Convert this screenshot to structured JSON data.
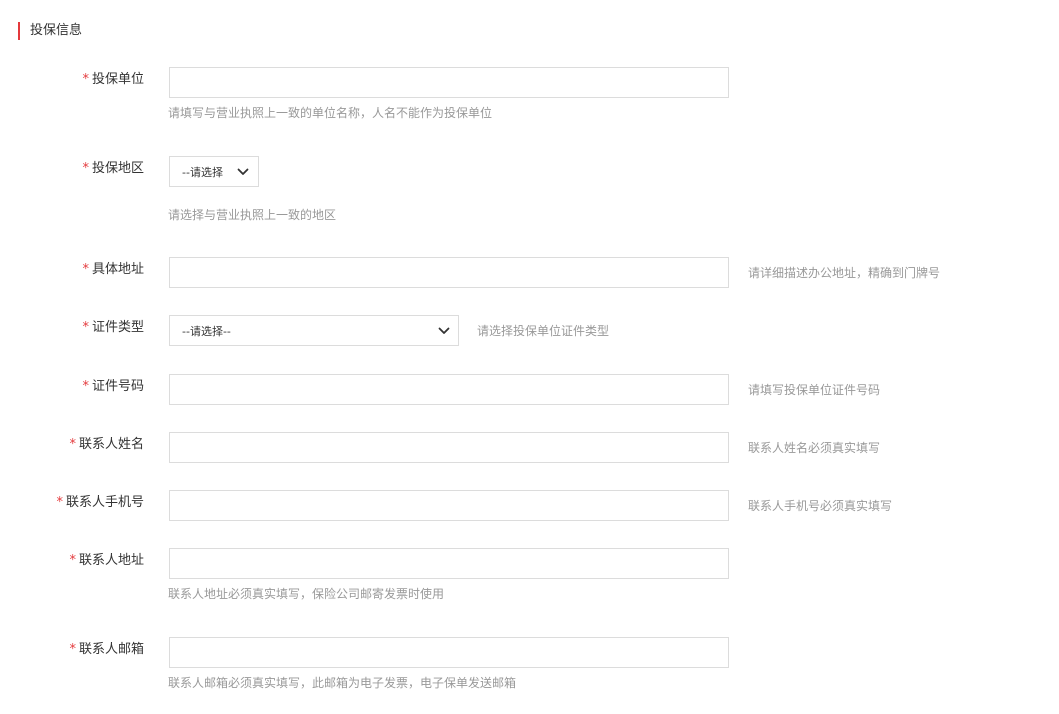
{
  "section": {
    "title": "投保信息"
  },
  "fields": {
    "company": {
      "required": "*",
      "label": "投保单位",
      "value": "",
      "hint": "请填写与营业执照上一致的单位名称，人名不能作为投保单位"
    },
    "region": {
      "required": "*",
      "label": "投保地区",
      "selected": "--请选择",
      "hint": "请选择与营业执照上一致的地区"
    },
    "address": {
      "required": "*",
      "label": "具体地址",
      "value": "",
      "hint": "请详细描述办公地址，精确到门牌号"
    },
    "cert_type": {
      "required": "*",
      "label": "证件类型",
      "selected": "--请选择--",
      "hint": "请选择投保单位证件类型"
    },
    "cert_number": {
      "required": "*",
      "label": "证件号码",
      "value": "",
      "hint": "请填写投保单位证件号码"
    },
    "contact_name": {
      "required": "*",
      "label": "联系人姓名",
      "value": "",
      "hint": "联系人姓名必须真实填写"
    },
    "contact_phone": {
      "required": "*",
      "label": "联系人手机号",
      "value": "",
      "hint": "联系人手机号必须真实填写"
    },
    "contact_address": {
      "required": "*",
      "label": "联系人地址",
      "value": "",
      "hint": "联系人地址必须真实填写，保险公司邮寄发票时使用"
    },
    "contact_email": {
      "required": "*",
      "label": "联系人邮箱",
      "value": "",
      "hint": "联系人邮箱必须真实填写，此邮箱为电子发票，电子保单发送邮箱"
    }
  },
  "icons": {
    "dropdown": "chevron-down-icon"
  },
  "colors": {
    "required": "#e4393c",
    "accent_bar": "#e4393c",
    "hint": "#999999",
    "border": "#dcdcdc"
  }
}
